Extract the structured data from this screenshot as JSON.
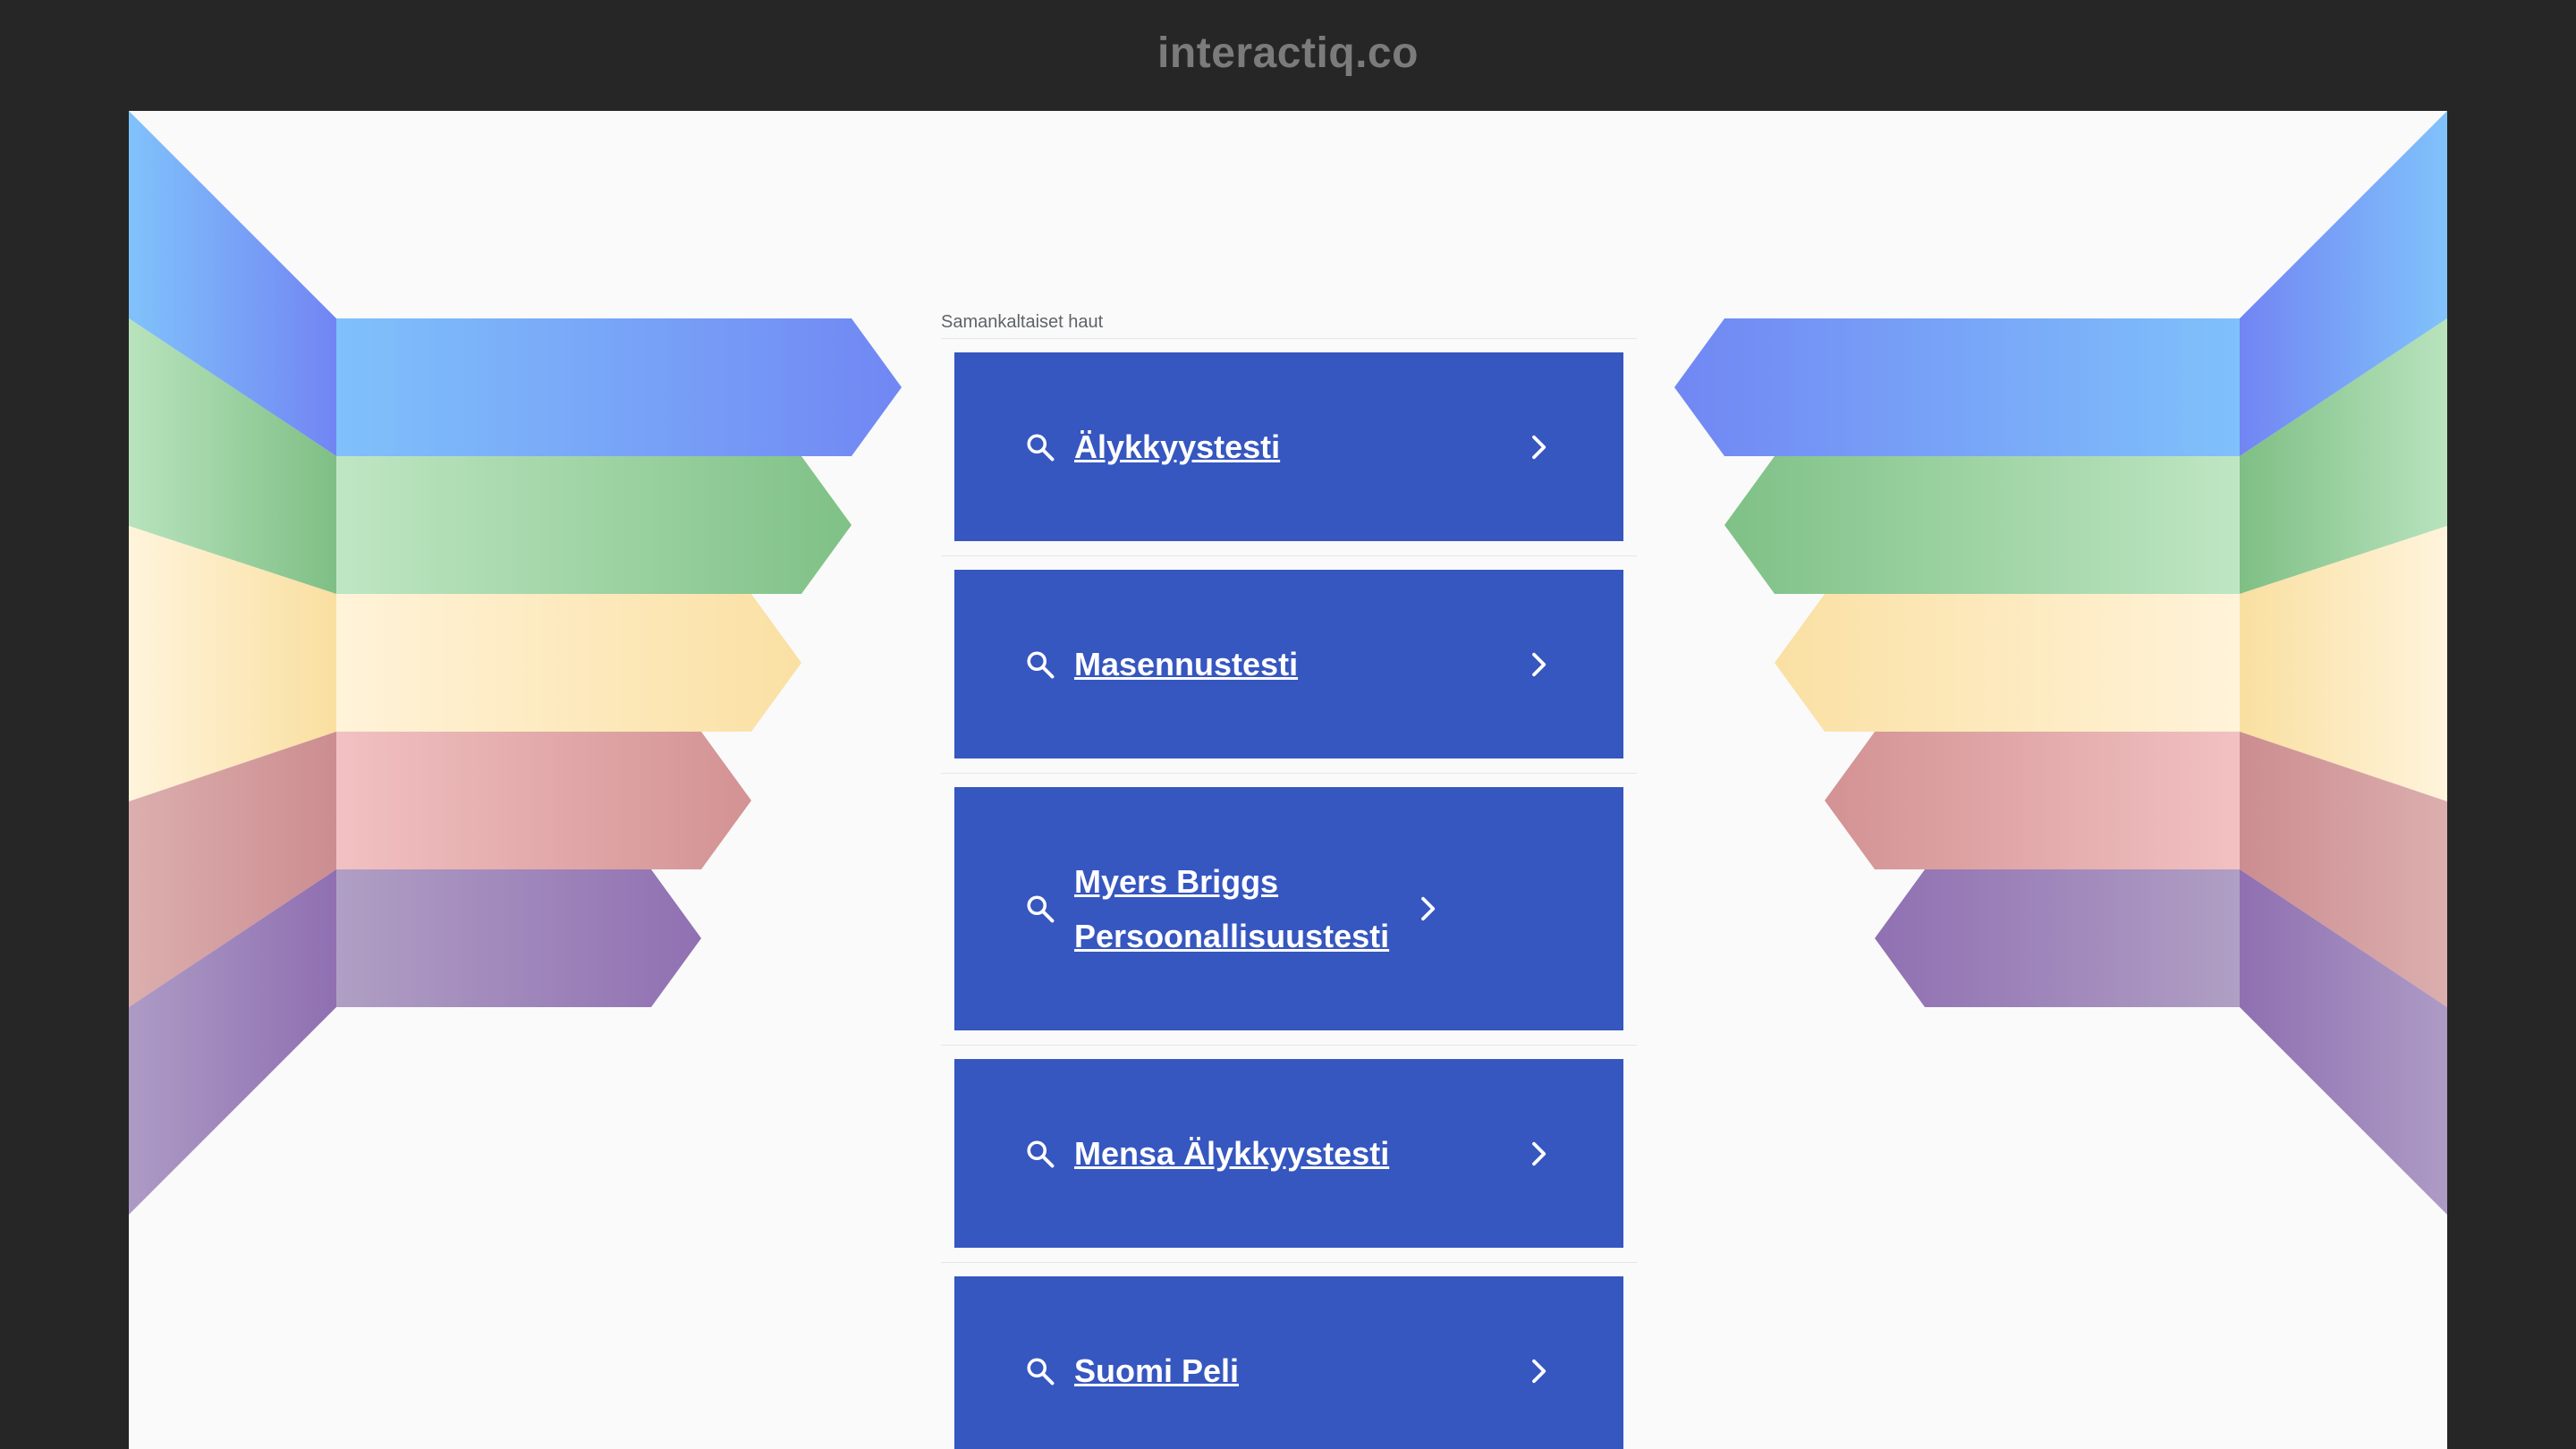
{
  "site": {
    "domain": "interactiq.co"
  },
  "related": {
    "heading": "Samankaltaiset haut",
    "items": [
      {
        "label": "Älykkyystesti",
        "icon": "search-icon"
      },
      {
        "label": "Masennustesti",
        "icon": "search-icon"
      },
      {
        "label": "Myers Briggs Persoonallisuustesti",
        "icon": "search-icon"
      },
      {
        "label": "Mensa Älykkyystesti",
        "icon": "search-icon"
      },
      {
        "label": "Suomi Peli",
        "icon": "search-icon"
      }
    ]
  },
  "colors": {
    "frame": "#262626",
    "page_background": "#fafafa",
    "result_button": "#3656c0",
    "ribbon_blue": "#6f8ff6",
    "ribbon_green": "#85c389",
    "ribbon_yellow": "#fbe3a6",
    "ribbon_red": "#d7999a",
    "ribbon_purple": "#9876b4"
  }
}
